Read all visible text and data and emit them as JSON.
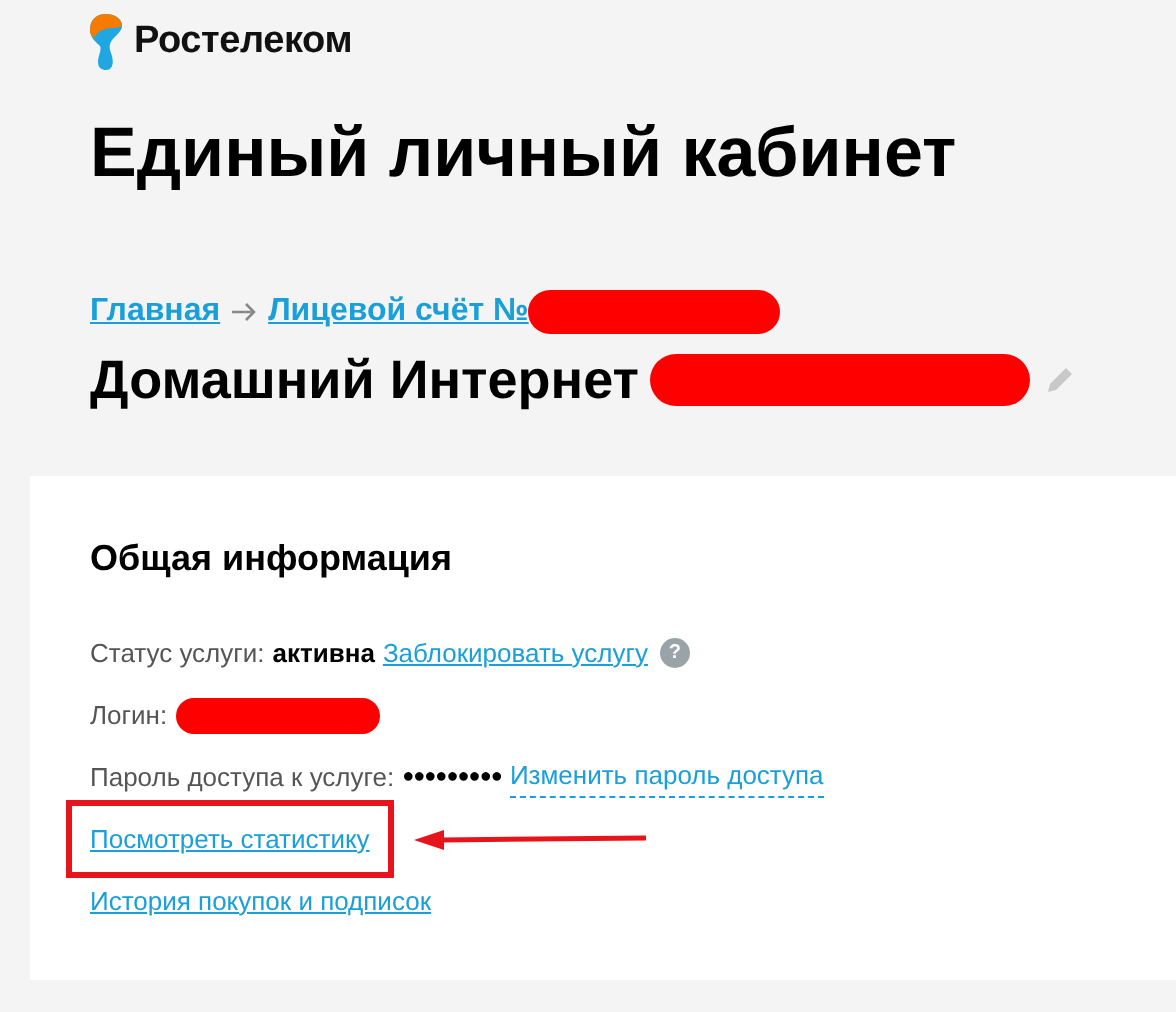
{
  "brand": {
    "name": "Ростелеком"
  },
  "title": "Единый личный кабинет",
  "breadcrumbs": [
    {
      "label": "Главная",
      "redacted": false
    },
    {
      "label": "Лицевой счёт №",
      "redacted": true
    }
  ],
  "service": {
    "name": "Домашний Интернет",
    "redacted": true
  },
  "card": {
    "title": "Общая информация",
    "rows": [
      {
        "kind": "status",
        "label": "Статус услуги:",
        "value": "активна",
        "link": "Заблокировать услугу",
        "help": "?"
      },
      {
        "kind": "login",
        "label": "Логин:"
      },
      {
        "kind": "password",
        "label": "Пароль доступа к услуге:",
        "value": "●●●●●●●●●",
        "link": "Изменить пароль доступа"
      },
      {
        "kind": "link",
        "link": "Посмотреть статистику",
        "annotated": true
      },
      {
        "kind": "link",
        "link": "История покупок и подписок",
        "annotated": false
      }
    ]
  }
}
